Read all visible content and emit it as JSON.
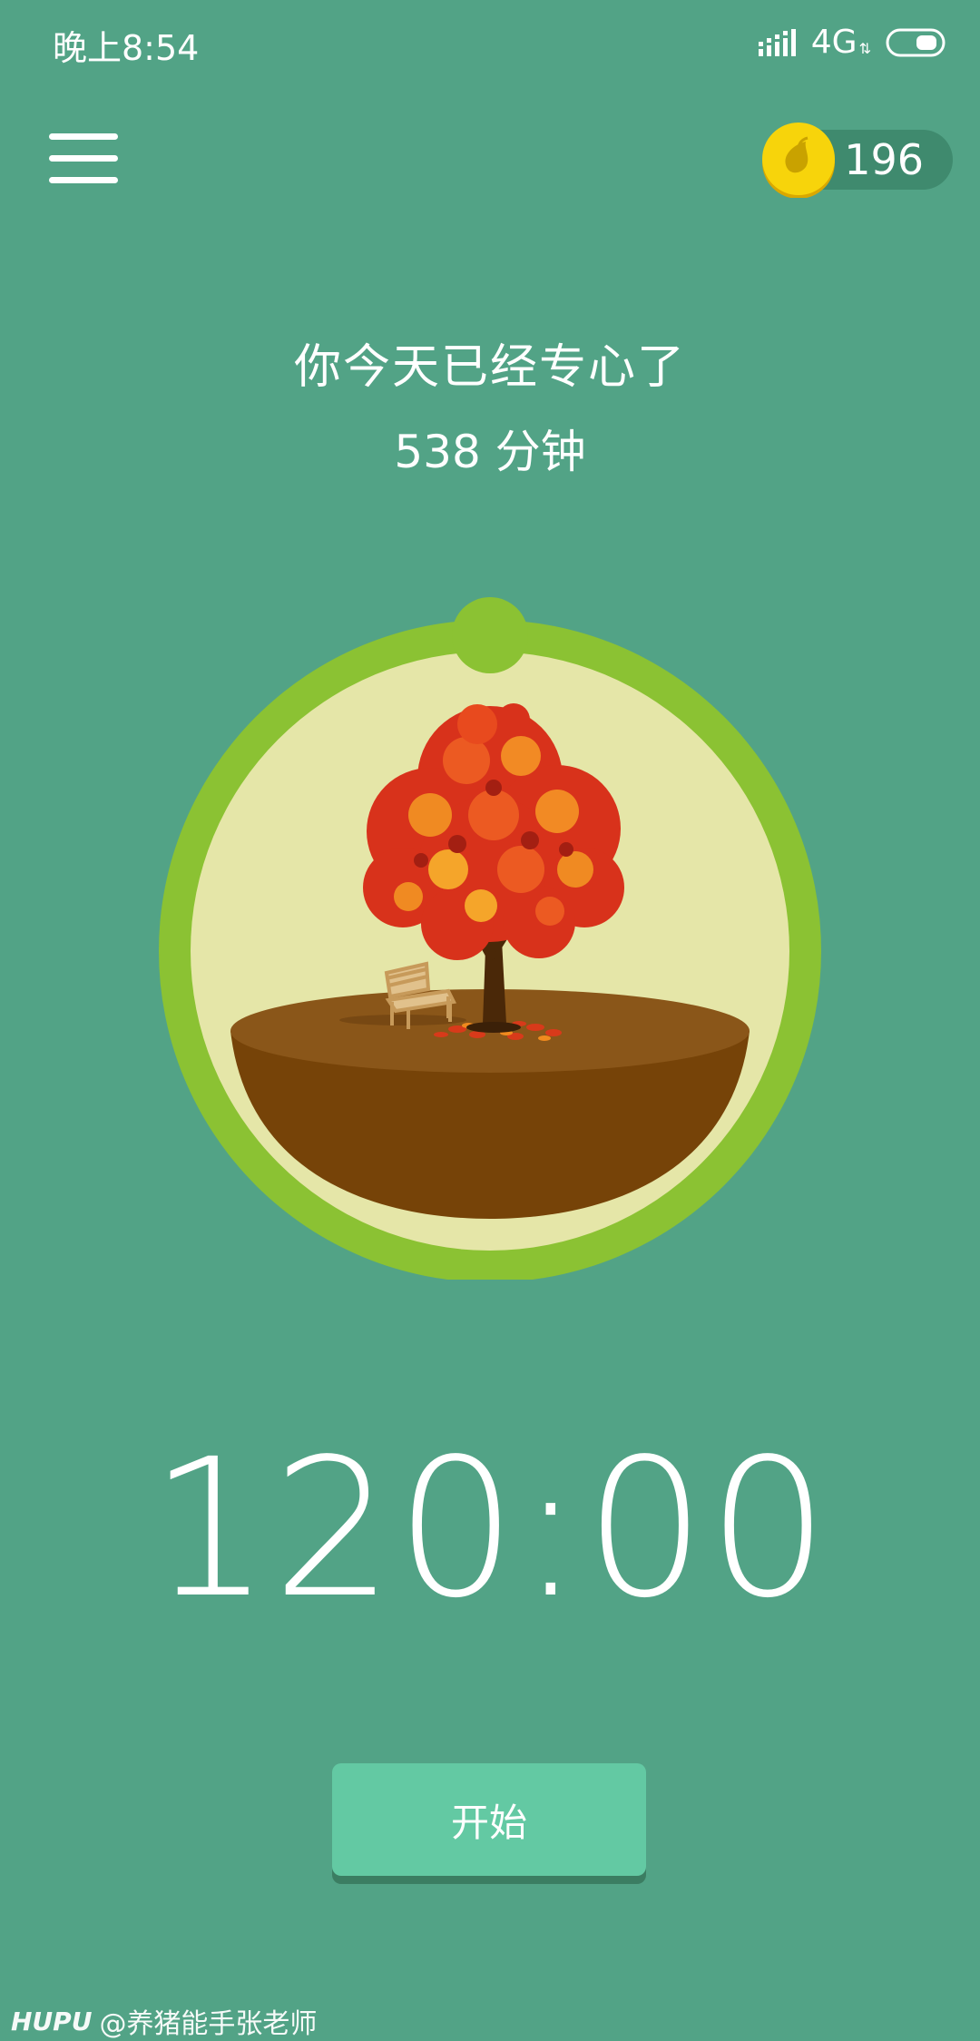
{
  "status_bar": {
    "time": "晚上8:54",
    "network": "4G",
    "network_arrows": "⇅",
    "signal_icon": "signal-icon",
    "battery_icon": "battery-icon"
  },
  "header": {
    "menu_icon": "hamburger-menu-icon",
    "coin_icon": "seed-coin-icon",
    "coin_count": "196"
  },
  "summary": {
    "title": "你今天已经专心了",
    "minutes": "538 分钟"
  },
  "dial": {
    "image": "maple-tree-on-island",
    "ring_color": "#8bc233",
    "inner_color": "#e5e6a8"
  },
  "timer": {
    "value": "120:00"
  },
  "start_button": {
    "label": "开始"
  },
  "watermark": {
    "logo": "HUPU",
    "text": "@养猪能手张老师"
  },
  "colors": {
    "background": "#52a386",
    "button": "#63c9a3",
    "coin": "#f7d40b"
  }
}
